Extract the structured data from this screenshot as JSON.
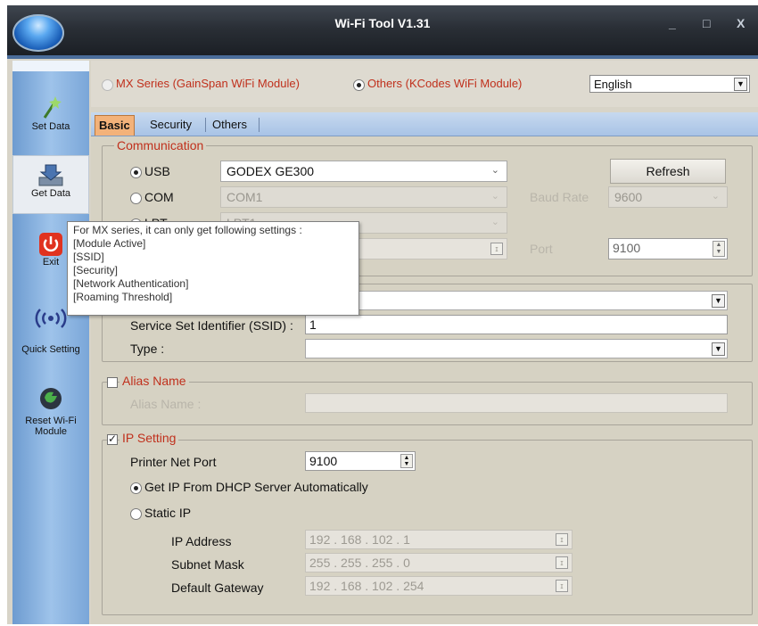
{
  "window": {
    "title": "Wi-Fi Tool V1.31",
    "minimize": "_",
    "maximize": "□",
    "close": "X"
  },
  "sidebar": {
    "items": [
      {
        "label": "Set Data",
        "icon": "wand-icon"
      },
      {
        "label": "Get Data",
        "icon": "download-tray-icon"
      },
      {
        "label": "Exit",
        "icon": "power-icon"
      },
      {
        "label": "Quick Setting",
        "icon": "wireless-signal-icon"
      },
      {
        "label": "Reset Wi-Fi Module",
        "icon": "reset-globe-icon"
      }
    ]
  },
  "module": {
    "option_mx": "MX Series (GainSpan WiFi Module)",
    "option_others": "Others (KCodes WiFi Module)",
    "selected": "others",
    "language": "English"
  },
  "tabs": [
    {
      "label": "Basic"
    },
    {
      "label": "Security"
    },
    {
      "label": "Others"
    }
  ],
  "communication": {
    "title": "Communication",
    "usb_label": "USB",
    "usb_value": "GODEX GE300",
    "com_label": "COM",
    "com_value": "COM1",
    "lpt_label": "LPT",
    "lpt_value": "LPT1",
    "baud_label": "Baud Rate",
    "baud_value": "9600",
    "port_label": "Port",
    "port_value": "9100",
    "refresh": "Refresh"
  },
  "wireless": {
    "ssid_label": "Service Set Identifier (SSID) :",
    "ssid_value": "1",
    "type_label": "Type :"
  },
  "alias": {
    "title": "Alias Name",
    "label": "Alias Name :",
    "value": ""
  },
  "ip": {
    "title": "IP Setting",
    "port_label": "Printer Net Port",
    "port_value": "9100",
    "dhcp_label": "Get IP From DHCP Server Automatically",
    "static_label": "Static IP",
    "ip_label": "IP Address",
    "ip_value": "192 . 168 . 102 . 1",
    "mask_label": "Subnet Mask",
    "mask_value": "255 . 255 . 255 . 0",
    "gw_label": "Default Gateway",
    "gw_value": "192 . 168 . 102 . 254"
  },
  "tooltip": {
    "lines": [
      "For MX series, it can only get following settings :",
      "[Module Active]",
      "[SSID]",
      "[Security]",
      "[Network Authentication]",
      "[Roaming Threshold]"
    ]
  }
}
